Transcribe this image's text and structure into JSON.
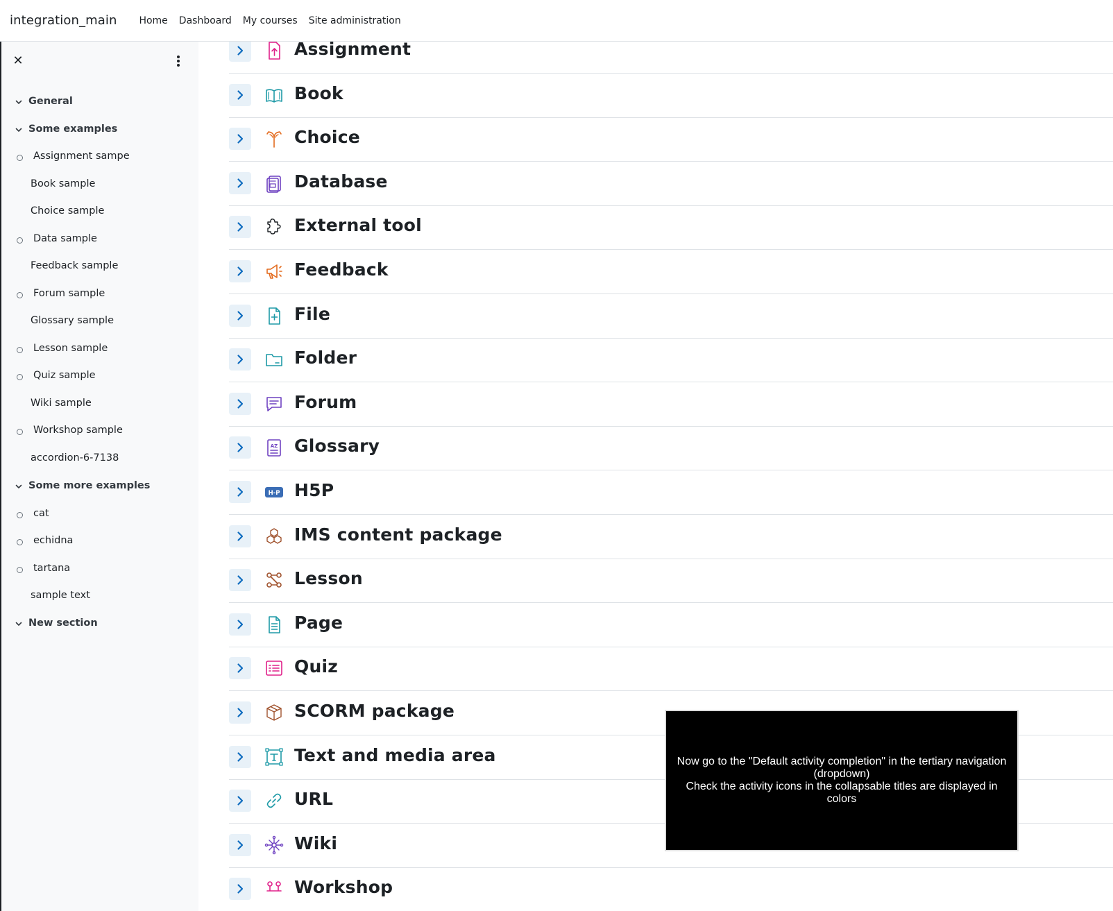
{
  "navbar": {
    "brand": "integration_main",
    "links": [
      "Home",
      "Dashboard",
      "My courses",
      "Site administration"
    ]
  },
  "drawer": {
    "close_icon": "close-icon",
    "menu_icon": "kebab-icon",
    "index": [
      {
        "type": "section",
        "label": "General"
      },
      {
        "type": "section",
        "label": "Some examples"
      },
      {
        "type": "item",
        "label": "Assignment sampe",
        "completion": true
      },
      {
        "type": "item",
        "label": "Book sample",
        "completion": false
      },
      {
        "type": "item",
        "label": "Choice sample",
        "completion": false
      },
      {
        "type": "item",
        "label": "Data sample",
        "completion": true
      },
      {
        "type": "item",
        "label": "Feedback sample",
        "completion": false
      },
      {
        "type": "item",
        "label": "Forum sample",
        "completion": true
      },
      {
        "type": "item",
        "label": "Glossary sample",
        "completion": false
      },
      {
        "type": "item",
        "label": "Lesson sample",
        "completion": true
      },
      {
        "type": "item",
        "label": "Quiz sample",
        "completion": true
      },
      {
        "type": "item",
        "label": "Wiki sample",
        "completion": false
      },
      {
        "type": "item",
        "label": "Workshop sample",
        "completion": true
      },
      {
        "type": "item",
        "label": "accordion-6-7138",
        "completion": false
      },
      {
        "type": "section",
        "label": "Some more examples"
      },
      {
        "type": "item",
        "label": "cat",
        "completion": true
      },
      {
        "type": "item",
        "label": "echidna",
        "completion": true
      },
      {
        "type": "item",
        "label": "tartana",
        "completion": true
      },
      {
        "type": "item",
        "label": "sample text",
        "completion": false
      },
      {
        "type": "section",
        "label": "New section"
      }
    ]
  },
  "activities": [
    {
      "title": "Assignment",
      "icon": "assignment-icon",
      "color": "#e0218a"
    },
    {
      "title": "Book",
      "icon": "book-icon",
      "color": "#1e9aa7"
    },
    {
      "title": "Choice",
      "icon": "choice-icon",
      "color": "#e36b1e"
    },
    {
      "title": "Database",
      "icon": "database-icon",
      "color": "#6f42c1"
    },
    {
      "title": "External tool",
      "icon": "puzzle-icon",
      "color": "#1d2125"
    },
    {
      "title": "Feedback",
      "icon": "megaphone-icon",
      "color": "#e36b1e"
    },
    {
      "title": "File",
      "icon": "file-icon",
      "color": "#1e9aa7"
    },
    {
      "title": "Folder",
      "icon": "folder-icon",
      "color": "#1e9aa7"
    },
    {
      "title": "Forum",
      "icon": "forum-icon",
      "color": "#6f42c1"
    },
    {
      "title": "Glossary",
      "icon": "glossary-icon",
      "color": "#6f42c1"
    },
    {
      "title": "H5P",
      "icon": "h5p-icon",
      "color": "#3a6db5",
      "badge": "H-P"
    },
    {
      "title": "IMS content package",
      "icon": "ims-package-icon",
      "color": "#a0522d"
    },
    {
      "title": "Lesson",
      "icon": "lesson-icon",
      "color": "#a0522d"
    },
    {
      "title": "Page",
      "icon": "page-icon",
      "color": "#1e9aa7"
    },
    {
      "title": "Quiz",
      "icon": "quiz-icon",
      "color": "#e0218a"
    },
    {
      "title": "SCORM package",
      "icon": "scorm-package-icon",
      "color": "#a0522d"
    },
    {
      "title": "Text and media area",
      "icon": "text-media-icon",
      "color": "#1e9aa7"
    },
    {
      "title": "URL",
      "icon": "link-icon",
      "color": "#1e9aa7"
    },
    {
      "title": "Wiki",
      "icon": "wiki-icon",
      "color": "#6f42c1"
    },
    {
      "title": "Workshop",
      "icon": "workshop-icon",
      "color": "#e0218a"
    }
  ],
  "overlay": {
    "lines": [
      "Now go to the \"Default activity completion\" in the tertiary navigation (dropdown)",
      "Check the activity icons in the collapsable titles are displayed in colors"
    ]
  }
}
